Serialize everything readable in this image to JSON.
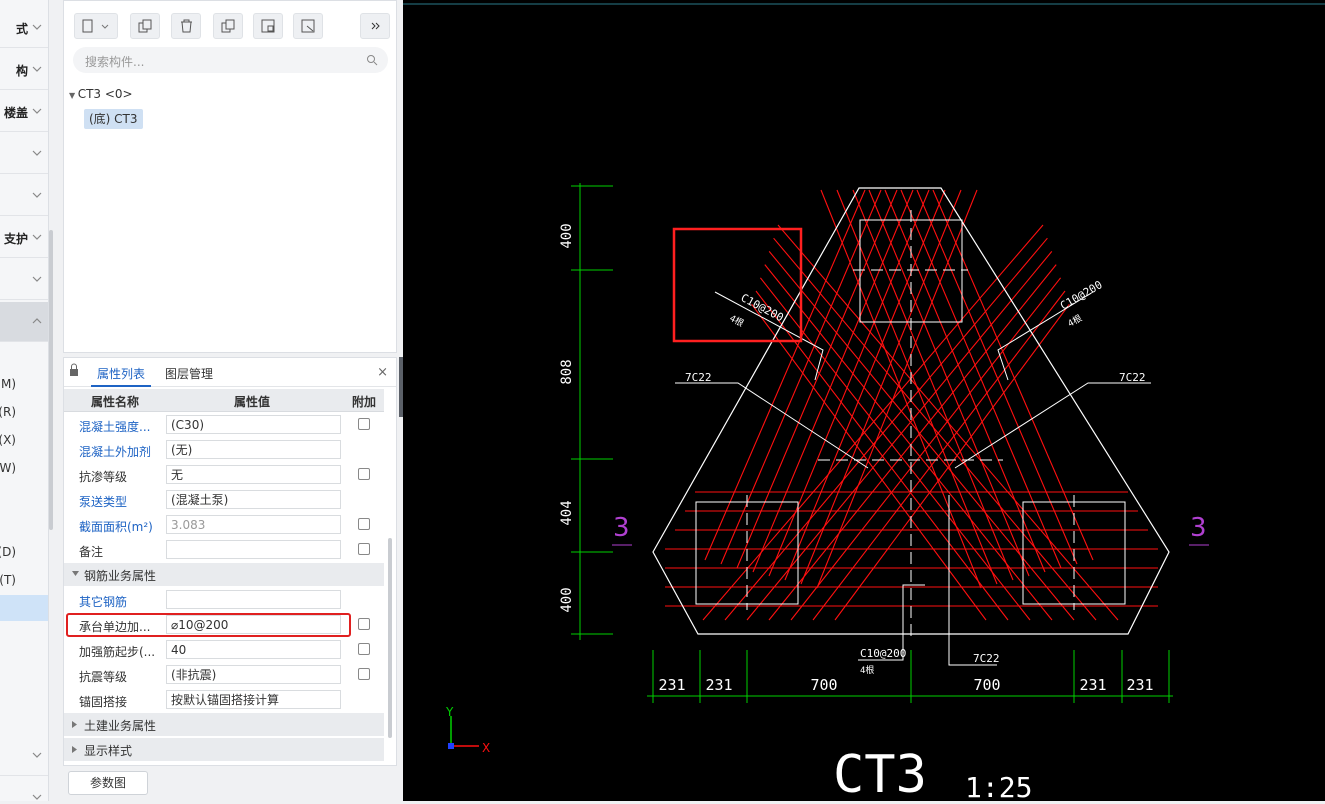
{
  "nav": {
    "items": [
      "式",
      "构",
      "楼盖",
      "",
      "",
      "支护",
      "",
      "",
      ""
    ],
    "sub_items": [
      "(M)",
      "(R)",
      "(X)",
      "(W)",
      "",
      "",
      "(D)",
      "(T)",
      ""
    ],
    "bottom_items": [
      "",
      ""
    ]
  },
  "component_panel": {
    "search_placeholder": "搜索构件...",
    "tree_root": "CT3 <0>",
    "tree_child": "(底) CT3"
  },
  "properties": {
    "tabs": [
      "属性列表",
      "图层管理"
    ],
    "headers": {
      "name": "属性名称",
      "value": "属性值",
      "extra": "附加"
    },
    "rows": [
      {
        "name": "混凝土强度...",
        "value": "(C30)",
        "blue": true,
        "checkbox": true
      },
      {
        "name": "混凝土外加剂",
        "value": "(无)",
        "blue": true,
        "checkbox": false
      },
      {
        "name": "抗渗等级",
        "value": "无",
        "blue": false,
        "checkbox": true
      },
      {
        "name": "泵送类型",
        "value": "(混凝土泵)",
        "blue": true,
        "checkbox": false
      },
      {
        "name": "截面面积(m²)",
        "value": "3.083",
        "blue": true,
        "checkbox": true,
        "gray": true
      },
      {
        "name": "备注",
        "value": "",
        "blue": false,
        "checkbox": true
      }
    ],
    "group_rebar": "钢筋业务属性",
    "rebar_rows": [
      {
        "name": "其它钢筋",
        "value": "",
        "blue": true,
        "checkbox": false
      },
      {
        "name": "承台单边加...",
        "value": "⌀10@200",
        "blue": false,
        "checkbox": true
      },
      {
        "name": "加强筋起步(...",
        "value": "40",
        "blue": false,
        "checkbox": true
      },
      {
        "name": "抗震等级",
        "value": "(非抗震)",
        "blue": false,
        "checkbox": true
      },
      {
        "name": "锚固搭接",
        "value": "按默认锚固搭接计算",
        "blue": false,
        "checkbox": false
      }
    ],
    "group_civil": "土建业务属性",
    "group_display": "显示样式",
    "close_icon": "×",
    "param_button": "参数图"
  },
  "cad": {
    "title": "CT3",
    "scale": "1:25",
    "section_mark": "3",
    "dim_vertical": [
      "400",
      "808",
      "404",
      "400"
    ],
    "dim_horizontal": [
      "231",
      "231",
      "700",
      "700",
      "231",
      "231"
    ],
    "rebar_labels": [
      "C10@200",
      "C10@200",
      "C10@200",
      "7C22",
      "7C22",
      "7C22"
    ],
    "sub_labels": [
      "4根",
      "4根",
      "4根"
    ],
    "axis_x": "X",
    "axis_y": "Y",
    "colors": {
      "background": "#000000",
      "outline": "#ffffff",
      "rebar": "#ff1010",
      "dim": "#00d000",
      "section": "#b040d0",
      "highlight": "#ff2020"
    }
  }
}
